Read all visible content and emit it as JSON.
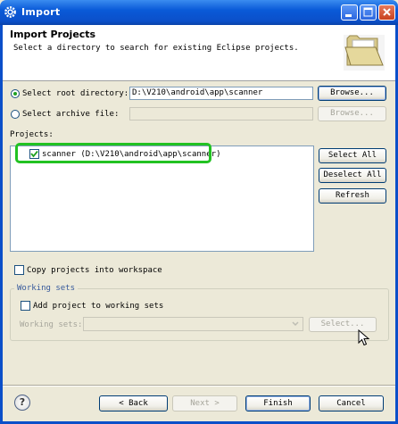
{
  "window": {
    "title": "Import"
  },
  "header": {
    "title": "Import Projects",
    "description": "Select a directory to search for existing Eclipse projects."
  },
  "root_dir": {
    "label": "Select root directory:",
    "value": "D:\\V210\\android\\app\\scanner",
    "browse": "Browse...",
    "selected": true
  },
  "archive": {
    "label": "Select archive file:",
    "value": "",
    "browse": "Browse...",
    "selected": false
  },
  "projects": {
    "label": "Projects:",
    "items": [
      {
        "label": "scanner (D:\\V210\\android\\app\\scanner)",
        "checked": true
      }
    ],
    "select_all": "Select All",
    "deselect_all": "Deselect All",
    "refresh": "Refresh"
  },
  "copy_projects": {
    "label": "Copy projects into workspace",
    "checked": false
  },
  "working_sets": {
    "title": "Working sets",
    "add_label": "Add project to working sets",
    "add_checked": false,
    "sets_label": "Working sets:",
    "sets_value": "",
    "select": "Select..."
  },
  "footer": {
    "back": "< Back",
    "next": "Next >",
    "finish": "Finish",
    "cancel": "Cancel",
    "help": "?"
  }
}
